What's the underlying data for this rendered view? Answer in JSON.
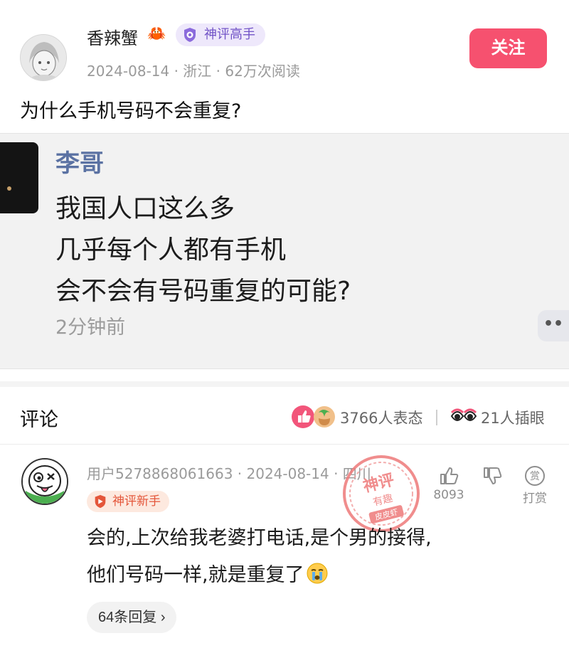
{
  "post": {
    "author": "香辣蟹",
    "author_emoji": "🦀",
    "badge": "神评高手",
    "meta": "2024-08-14 · 浙江 · 62万次阅读",
    "follow_label": "关注",
    "title": "为什么手机号码不会重复?"
  },
  "quote": {
    "sender": "李哥",
    "lines": [
      "我国人口这么多",
      "几乎每个人都有手机",
      "会不会有号码重复的可能?"
    ],
    "time": "2分钟前",
    "more_icon": "ellipsis-icon"
  },
  "comments_header": {
    "label": "评论",
    "reaction_count": "3766人表态",
    "eyes_count": "21人插眼"
  },
  "comment": {
    "user_meta": "用户5278868061663 · 2024-08-14 · 四川",
    "badge": "神评新手",
    "text_lines": [
      "会的,上次给我老婆打电话,是个男的接得,",
      "他们号码一样,就是重复了"
    ],
    "text_emoji": "crying-face-emoji",
    "like_count": "8093",
    "tip_label": "打赏",
    "tip_glyph": "赏",
    "reply_label": "64条回复",
    "reply_chevron": "›"
  },
  "stamp": {
    "line1": "神评",
    "line2": "有趣",
    "line3": "皮皮虾"
  },
  "colors": {
    "accent": "#f6516f",
    "pro_badge": "#7153c7",
    "new_badge": "#e4563a",
    "quote_sender": "#5b72a3"
  }
}
